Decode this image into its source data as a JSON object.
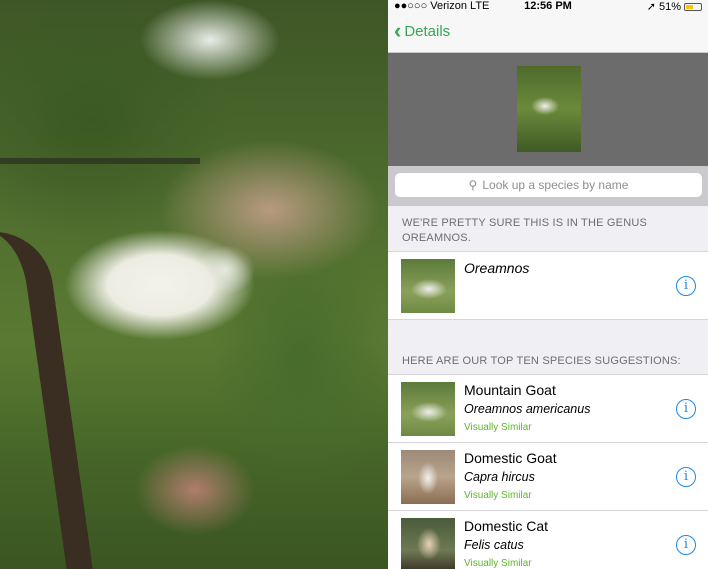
{
  "status": {
    "carrier": "●●○○○ Verizon  LTE",
    "time": "12:56 PM",
    "battery": "51%",
    "battery_level": 0.51,
    "location_icon": "arrow-icon"
  },
  "nav": {
    "back_label": "Details",
    "back_icon": "chevron-left-icon"
  },
  "search": {
    "placeholder": "Look up a species by name",
    "icon": "magnifier-icon"
  },
  "genus": {
    "header": "WE'RE PRETTY SURE THIS IS IN THE GENUS OREAMNOS.",
    "name": "Oreamnos"
  },
  "suggestions": {
    "header": "HERE ARE OUR TOP TEN SPECIES SUGGESTIONS:",
    "items": [
      {
        "common": "Mountain Goat",
        "scientific": "Oreamnos americanus",
        "tag": "Visually Similar"
      },
      {
        "common": "Domestic Goat",
        "scientific": "Capra hircus",
        "tag": "Visually Similar"
      },
      {
        "common": "Domestic Cat",
        "scientific": "Felis catus",
        "tag": "Visually Similar"
      }
    ]
  },
  "colors": {
    "accent": "#34a853",
    "info": "#1e88e5",
    "tag": "#5cb82a"
  }
}
